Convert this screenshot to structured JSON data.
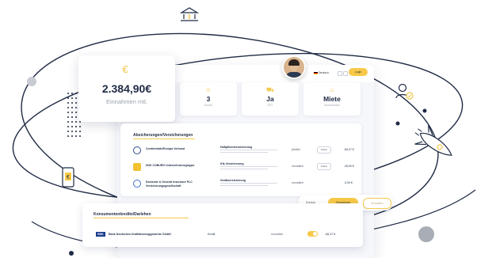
{
  "colors": {
    "accent": "#f7c948",
    "navy": "#1f2a44",
    "muted": "#9aa0ae"
  },
  "income_card": {
    "amount": "2.384,90€",
    "label": "Einnahmen mtl.",
    "icon": "money-bag-icon"
  },
  "header": {
    "language": "Deutsch",
    "login_label": "Login"
  },
  "stats": [
    {
      "icon": "children-icon",
      "value": "3",
      "label": "Kinder"
    },
    {
      "icon": "car-icon",
      "value": "Ja",
      "label": "KFZ"
    },
    {
      "icon": "house-icon",
      "value": "Miete",
      "label": "Wohnkosten"
    }
  ],
  "insurance": {
    "title": "Absicherungen/Versicherungen",
    "rows": [
      {
        "logo": "C",
        "logo_color": "#2b4a8a",
        "name": "Continentale/Europa Verbund",
        "type": "Haftpflichtversicherung",
        "freq": "jährlich",
        "badge": "Police",
        "price": "-66,37 €"
      },
      {
        "logo": "HUK",
        "logo_color": "#f2c230",
        "name": "HUK COBURG Unternehmensgruppe",
        "type": "Kfz-Versicherung",
        "freq": "monatlich",
        "badge": "Police",
        "price": "-28,90 €"
      },
      {
        "logo": "DG",
        "logo_color": "#3d6fd1",
        "name": "Domestic & General Insurance PLC Versicherungsgesellschaft",
        "type": "Gerätversicherung",
        "freq": "monatlich",
        "badge": "",
        "price": "-3,99 €"
      }
    ]
  },
  "actions": {
    "back": "Zurück",
    "download": "Download",
    "print": "Drucken"
  },
  "credits": {
    "title": "Konsumentenkredite/Darlehen",
    "rows": [
      {
        "logo": "BDK",
        "name": "Bank Deutsches Kraftfahrzeuggewerbe GmbH",
        "type": "Kredit",
        "freq": "monatlich",
        "price": "-56,37 €"
      }
    ]
  }
}
